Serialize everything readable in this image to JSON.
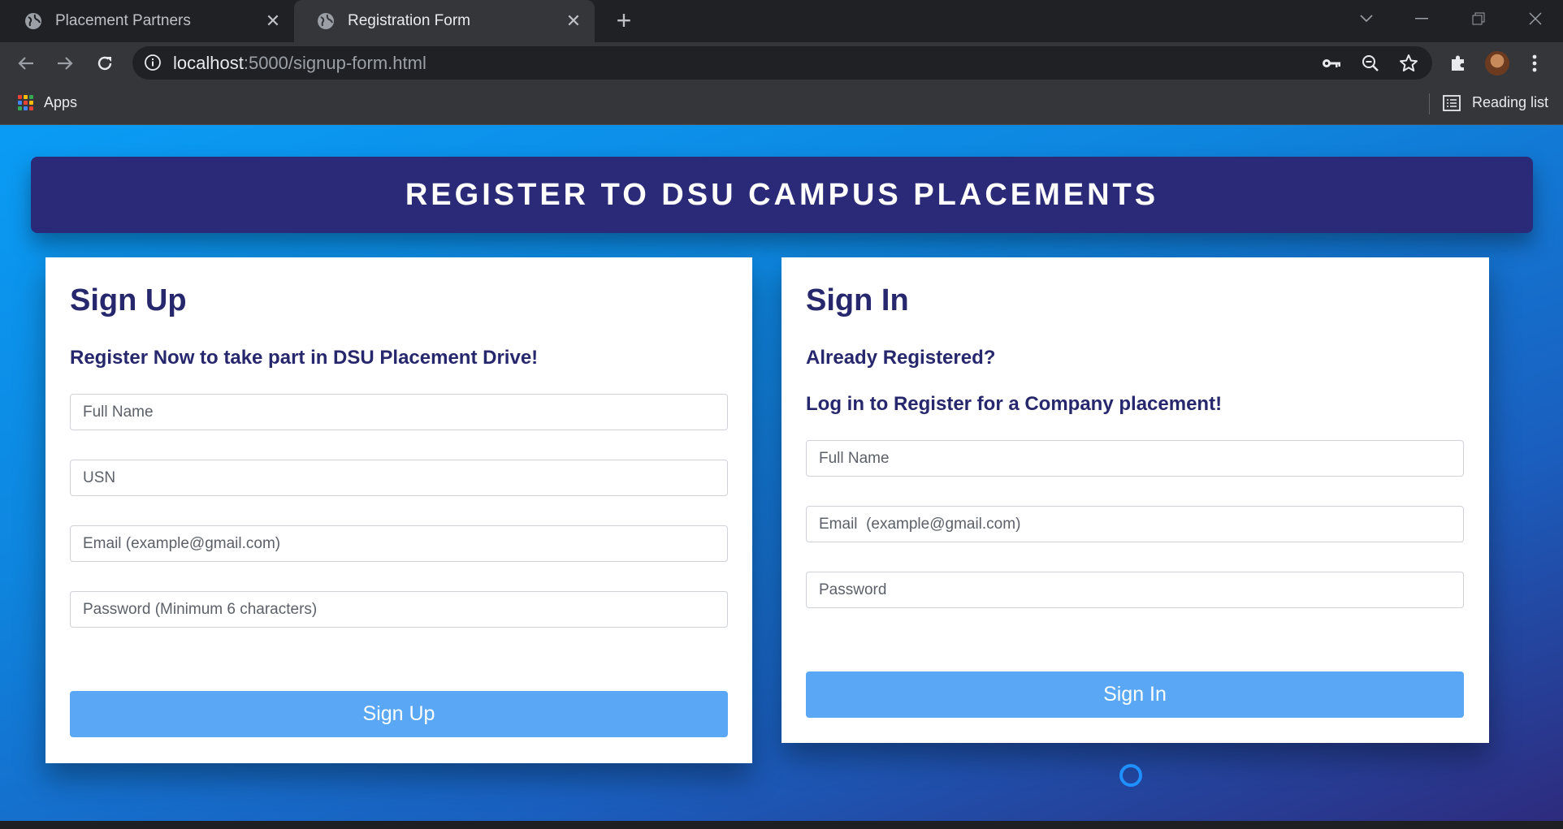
{
  "browser": {
    "tabs": [
      {
        "title": "Placement Partners",
        "active": false
      },
      {
        "title": "Registration Form",
        "active": true
      }
    ],
    "address": {
      "host": "localhost",
      "path": ":5000/signup-form.html"
    },
    "bookmarks": {
      "apps_label": "Apps",
      "reading_list_label": "Reading list"
    },
    "icons": [
      "back-icon",
      "forward-icon",
      "reload-icon",
      "info-icon",
      "key-icon",
      "zoom-icon",
      "star-icon",
      "extensions-icon",
      "avatar",
      "menu-icon"
    ]
  },
  "page": {
    "banner_title": "REGISTER TO DSU CAMPUS PLACEMENTS",
    "signup": {
      "heading": "Sign Up",
      "subheading": "Register Now to take part in DSU Placement Drive!",
      "fields": {
        "full_name": {
          "placeholder": "Full Name",
          "value": ""
        },
        "usn": {
          "placeholder": "USN",
          "value": ""
        },
        "email": {
          "placeholder": "Email (example@gmail.com)",
          "value": ""
        },
        "password": {
          "placeholder": "Password (Minimum 6 characters)",
          "value": ""
        }
      },
      "button_label": "Sign Up"
    },
    "signin": {
      "heading": "Sign In",
      "subheading_1": "Already Registered?",
      "subheading_2": "Log in to Register for a Company placement!",
      "fields": {
        "full_name": {
          "placeholder": "Full Name",
          "value": ""
        },
        "email": {
          "placeholder": "Email  (example@gmail.com)",
          "value": ""
        },
        "password": {
          "placeholder": "Password",
          "value": ""
        }
      },
      "button_label": "Sign In"
    }
  },
  "colors": {
    "banner_bg": "#2a2a78",
    "heading_text": "#27276e",
    "button_bg": "#5aa8f5",
    "gradient_start": "#0a9cf5",
    "gradient_end": "#2e2b7e",
    "spinner": "#1e90ff"
  }
}
